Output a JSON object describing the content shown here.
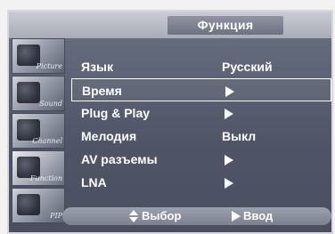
{
  "menu": {
    "title": "Функция",
    "items": [
      {
        "label": "Язык",
        "value": "Русский"
      },
      {
        "label": "Время",
        "value": "▶"
      },
      {
        "label": "Plug & Play",
        "value": "▶"
      },
      {
        "label": "Мелодия",
        "value": "Выкл"
      },
      {
        "label": "AV разъемы",
        "value": "▶"
      },
      {
        "label": "LNA",
        "value": "▶"
      }
    ],
    "selected_index": 1
  },
  "sidebar": {
    "items": [
      {
        "label": "Picture",
        "icon": "picture-icon"
      },
      {
        "label": "Sound",
        "icon": "sound-icon"
      },
      {
        "label": "Channel",
        "icon": "channel-icon"
      },
      {
        "label": "Function",
        "icon": "function-icon"
      },
      {
        "label": "PIP",
        "icon": "pip-icon"
      }
    ],
    "active_index": 3
  },
  "footer": {
    "move_label": "Выбор",
    "enter_label": "Ввод"
  }
}
